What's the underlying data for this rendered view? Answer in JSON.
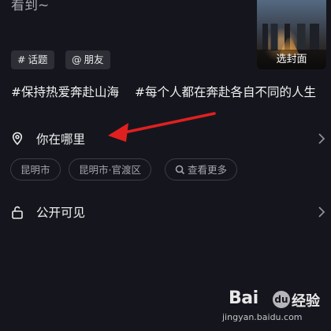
{
  "caption_tail": "看到~",
  "cover": {
    "label": "选封面"
  },
  "tags": [
    {
      "symbol": "#",
      "label": "话题"
    },
    {
      "symbol": "@",
      "label": "朋友"
    }
  ],
  "hashtags": [
    "#保持热爱奔赴山海",
    "#每个人都在奔赴各自不同的人生"
  ],
  "location": {
    "label": "你在哪里",
    "chips": [
      "昆明市",
      "昆明市·官渡区",
      "查看更多"
    ]
  },
  "privacy": {
    "label": "公开可见"
  },
  "annotation": {
    "color": "#e02020"
  },
  "watermark": {
    "logo": "Bai",
    "paw": "du",
    "name": "经验",
    "url": "jingyan.baidu.com"
  }
}
